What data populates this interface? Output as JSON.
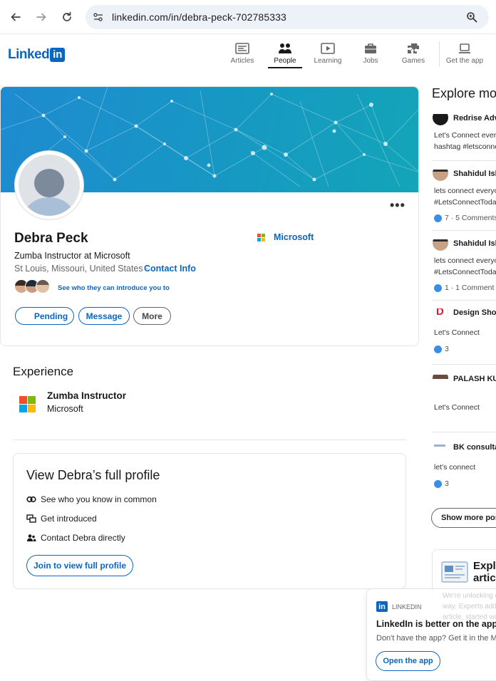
{
  "browser": {
    "url": "linkedin.com/in/debra-peck-702785333"
  },
  "header": {
    "logo_text": "Linked",
    "logo_in": "in",
    "nav": [
      {
        "label": "Articles",
        "icon": "articles-icon"
      },
      {
        "label": "People",
        "icon": "people-icon",
        "active": true
      },
      {
        "label": "Learning",
        "icon": "learning-icon"
      },
      {
        "label": "Jobs",
        "icon": "jobs-icon"
      },
      {
        "label": "Games",
        "icon": "games-icon"
      },
      {
        "label": "Get the app",
        "icon": "laptop-icon"
      }
    ]
  },
  "profile": {
    "name": "Debra Peck",
    "headline": "Zumba Instructor at Microsoft",
    "location": "St Louis, Missouri, United States",
    "separator": "·",
    "contact_info": "Contact Info",
    "company": "Microsoft",
    "intro_text": "See who they can introduce you to",
    "buttons": {
      "pending": "Pending",
      "message": "Message",
      "more": "More"
    },
    "more_dots": "•••"
  },
  "experience": {
    "title": "Experience",
    "role": "Zumba Instructor",
    "company": "Microsoft"
  },
  "full_profile": {
    "title": "View Debra’s full profile",
    "items": [
      "See who you know in common",
      "Get introduced",
      "Contact Debra directly"
    ],
    "join_button": "Join to view full profile"
  },
  "sidebar": {
    "title": "Explore mo",
    "posts": [
      {
        "author": "Redrise Advi",
        "lines": [
          "Let's Connect every",
          "hashtag #letsconne"
        ],
        "reactions": ""
      },
      {
        "author": "Shahidul Isla",
        "lines": [
          "lets connect everyo",
          "#LetsConnectToday"
        ],
        "reactions": "7 · 5 Comments"
      },
      {
        "author": "Shahidul Isla",
        "lines": [
          "lets connect everyo",
          "#LetsConnectToday"
        ],
        "reactions": "1 · 1 Comment"
      },
      {
        "author": "Design Show",
        "lines": [
          "Let's Connect"
        ],
        "reactions": "3"
      },
      {
        "author": "PALASH KUM",
        "lines": [
          "Let's Connect"
        ],
        "reactions": ""
      },
      {
        "author": "BK consultar",
        "lines": [
          "let's connect"
        ],
        "reactions": "3"
      }
    ],
    "show_more": "Show more post",
    "article_card_title_1": "Explo",
    "article_card_title_2": "articl"
  },
  "app_popup": {
    "brand": "LINKEDIN",
    "title": "LinkedIn is better on the app",
    "subtitle": "Don't have the app? Get it in the Mic",
    "button": "Open the app",
    "ghost_lines": [
      "We're unlocking c",
      "way. Experts add",
      "article, started wi"
    ]
  },
  "colors": {
    "brand": "#0a66c2",
    "banner": "#1797c4"
  }
}
